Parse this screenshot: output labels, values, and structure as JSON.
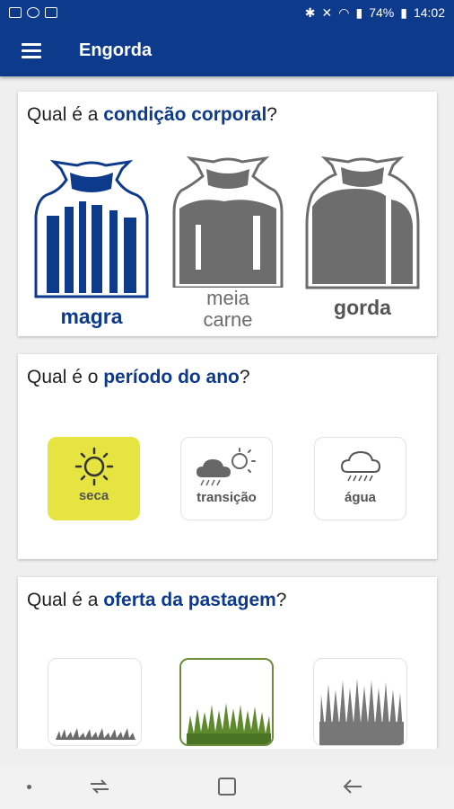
{
  "status": {
    "battery": "74%",
    "time": "14:02"
  },
  "app": {
    "title": "Engorda"
  },
  "sections": {
    "body": {
      "prefix": "Qual é a ",
      "highlight": "condição corporal",
      "suffix": "?",
      "options": [
        {
          "line1": "magra",
          "line2": "",
          "color": "#0e3a8c"
        },
        {
          "line1": "meia",
          "line2": "carne",
          "color": "#6d6d6d"
        },
        {
          "line1": "gorda",
          "line2": "",
          "color": "#555555"
        }
      ]
    },
    "period": {
      "prefix": "Qual é o ",
      "highlight": "período do ano",
      "suffix": "?",
      "options": [
        {
          "label": "seca",
          "icon": "sun-icon"
        },
        {
          "label": "transição",
          "icon": "cloud-sun-rain-icon"
        },
        {
          "label": "água",
          "icon": "rain-cloud-icon"
        }
      ]
    },
    "pasture": {
      "prefix": "Qual é a ",
      "highlight": "oferta da pastagem",
      "suffix": "?",
      "options": [
        {
          "icon": "short-grass-icon"
        },
        {
          "icon": "medium-grass-icon"
        },
        {
          "icon": "tall-grass-icon"
        }
      ]
    }
  },
  "colors": {
    "primary": "#0e3a8c",
    "selected_season": "#e6e441",
    "grass_green": "#5d8a2d"
  }
}
